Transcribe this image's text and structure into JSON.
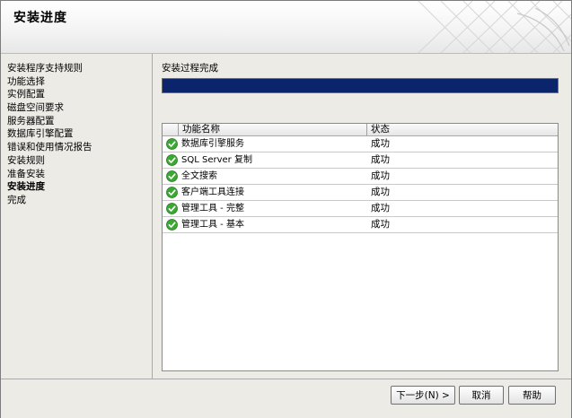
{
  "header": {
    "title": "安装进度"
  },
  "sidebar": {
    "items": [
      {
        "label": "安装程序支持规则"
      },
      {
        "label": "功能选择"
      },
      {
        "label": "实例配置"
      },
      {
        "label": "磁盘空间要求"
      },
      {
        "label": "服务器配置"
      },
      {
        "label": "数据库引擎配置"
      },
      {
        "label": "错误和使用情况报告"
      },
      {
        "label": "安装规则"
      },
      {
        "label": "准备安装"
      },
      {
        "label": "安装进度",
        "active": true
      },
      {
        "label": "完成"
      }
    ]
  },
  "main": {
    "status_text": "安装过程完成",
    "progress": 1.0,
    "table": {
      "columns": [
        "功能名称",
        "状态"
      ],
      "rows": [
        {
          "name": "数据库引擎服务",
          "status": "成功",
          "icon": "success-check-icon"
        },
        {
          "name": "SQL Server 复制",
          "status": "成功",
          "icon": "success-check-icon"
        },
        {
          "name": "全文搜索",
          "status": "成功",
          "icon": "success-check-icon"
        },
        {
          "name": "客户端工具连接",
          "status": "成功",
          "icon": "success-check-icon"
        },
        {
          "name": "管理工具 - 完整",
          "status": "成功",
          "icon": "success-check-icon"
        },
        {
          "name": "管理工具 - 基本",
          "status": "成功",
          "icon": "success-check-icon"
        }
      ]
    }
  },
  "footer": {
    "next_label": "下一步(N) >",
    "cancel_label": "取消",
    "help_label": "帮助"
  },
  "colors": {
    "progress_fill": "#0c246c",
    "success_green": "#3aa832"
  }
}
